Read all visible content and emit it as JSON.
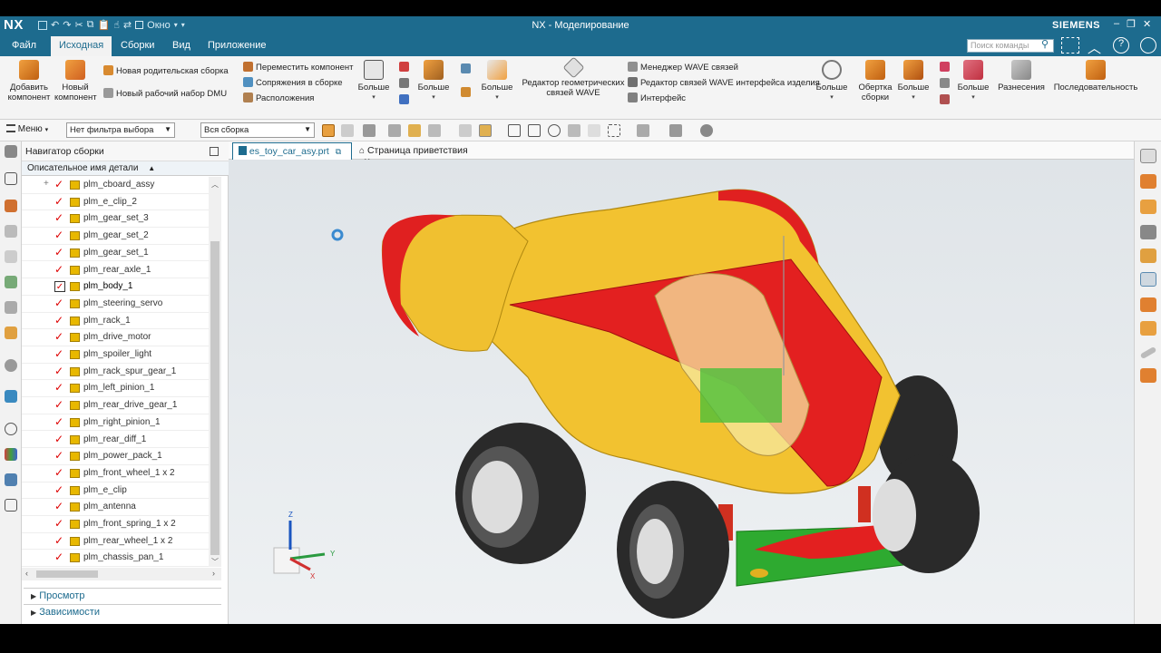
{
  "app": {
    "logo": "NX",
    "window_title": "NX - Моделирование",
    "brand": "SIEMENS",
    "window_menu": "Окно",
    "brand_color": "#1d6b8e"
  },
  "menu": {
    "tabs": [
      "Файл",
      "Исходная",
      "Сборки",
      "Вид",
      "Приложение"
    ],
    "active": "Исходная",
    "search_placeholder": "Поиск команды"
  },
  "ribbon": {
    "add_component": "Добавить компонент",
    "new_component": "Новый компонент",
    "new_parent_assembly": "Новая родительская сборка",
    "new_dmu_workset": "Новый рабочий набор DMU",
    "move_component": "Переместить компонент",
    "assembly_constraints": "Сопряжения в сборке",
    "arrangements": "Расположения",
    "more_1": "Больше",
    "more_2": "Больше",
    "more_3": "Больше",
    "wave_geometry_editor": "Редактор геометрических связей WAVE",
    "wave_link_manager": "Менеджер WAVE связей",
    "wave_interface_editor": "Редактор связей WAVE интерфейса изделия",
    "interface": "Интерфейс",
    "more_4": "Больше",
    "assembly_wrap": "Обертка сборки",
    "more_5": "Больше",
    "more_6": "Больше",
    "exploded_views": "Разнесения",
    "sequence": "Последовательность"
  },
  "toolbar": {
    "menu_label": "Меню",
    "selection_filter": "Нет фильтра выбора",
    "scope": "Вся сборка"
  },
  "navigator": {
    "title": "Навигатор сборки",
    "column_header": "Описательное имя детали",
    "items": [
      {
        "name": "plm_cboard_assy",
        "expandable": true,
        "checked": true
      },
      {
        "name": "plm_e_clip_2",
        "checked": true
      },
      {
        "name": "plm_gear_set_3",
        "checked": true
      },
      {
        "name": "plm_gear_set_2",
        "checked": true
      },
      {
        "name": "plm_gear_set_1",
        "checked": true
      },
      {
        "name": "plm_rear_axle_1",
        "checked": true
      },
      {
        "name": "plm_body_1",
        "checked": true,
        "work_part": true
      },
      {
        "name": "plm_steering_servo",
        "checked": true
      },
      {
        "name": "plm_rack_1",
        "checked": true
      },
      {
        "name": "plm_drive_motor",
        "checked": true
      },
      {
        "name": "plm_spoiler_light",
        "checked": true
      },
      {
        "name": "plm_rack_spur_gear_1",
        "checked": true
      },
      {
        "name": "plm_left_pinion_1",
        "checked": true
      },
      {
        "name": "plm_rear_drive_gear_1",
        "checked": true
      },
      {
        "name": "plm_right_pinion_1",
        "checked": true
      },
      {
        "name": "plm_rear_diff_1",
        "checked": true
      },
      {
        "name": "plm_power_pack_1",
        "checked": true
      },
      {
        "name": "plm_front_wheel_1 x 2",
        "checked": true
      },
      {
        "name": "plm_e_clip",
        "checked": true
      },
      {
        "name": "plm_antenna",
        "checked": true
      },
      {
        "name": "plm_front_spring_1 x 2",
        "checked": true
      },
      {
        "name": "plm_rear_wheel_1 x 2",
        "checked": true
      },
      {
        "name": "plm_chassis_pan_1",
        "checked": true
      }
    ],
    "sections": [
      "Просмотр",
      "Зависимости"
    ]
  },
  "doc_tabs": [
    {
      "label": "es_toy_car_asy.prt",
      "active": true
    },
    {
      "label": "Страница приветствия",
      "active": false
    }
  ],
  "triad": {
    "x": "X",
    "y": "Y",
    "z": "Z"
  }
}
